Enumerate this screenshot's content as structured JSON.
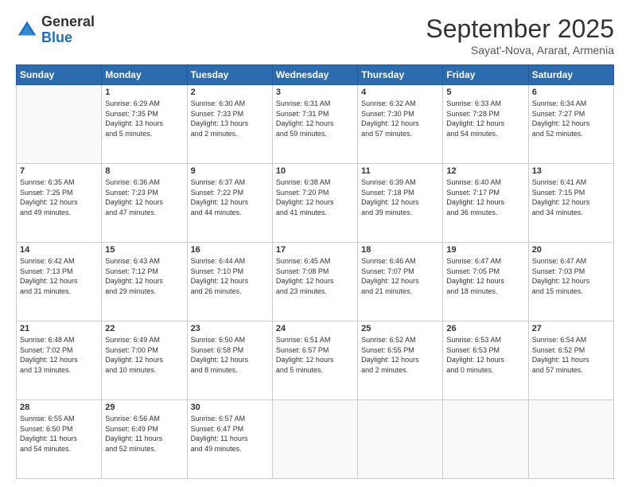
{
  "header": {
    "logo_general": "General",
    "logo_blue": "Blue",
    "month": "September 2025",
    "location": "Sayat'-Nova, Ararat, Armenia"
  },
  "columns": [
    "Sunday",
    "Monday",
    "Tuesday",
    "Wednesday",
    "Thursday",
    "Friday",
    "Saturday"
  ],
  "weeks": [
    [
      {
        "day": "",
        "text": ""
      },
      {
        "day": "1",
        "text": "Sunrise: 6:29 AM\nSunset: 7:35 PM\nDaylight: 13 hours\nand 5 minutes."
      },
      {
        "day": "2",
        "text": "Sunrise: 6:30 AM\nSunset: 7:33 PM\nDaylight: 13 hours\nand 2 minutes."
      },
      {
        "day": "3",
        "text": "Sunrise: 6:31 AM\nSunset: 7:31 PM\nDaylight: 12 hours\nand 59 minutes."
      },
      {
        "day": "4",
        "text": "Sunrise: 6:32 AM\nSunset: 7:30 PM\nDaylight: 12 hours\nand 57 minutes."
      },
      {
        "day": "5",
        "text": "Sunrise: 6:33 AM\nSunset: 7:28 PM\nDaylight: 12 hours\nand 54 minutes."
      },
      {
        "day": "6",
        "text": "Sunrise: 6:34 AM\nSunset: 7:27 PM\nDaylight: 12 hours\nand 52 minutes."
      }
    ],
    [
      {
        "day": "7",
        "text": "Sunrise: 6:35 AM\nSunset: 7:25 PM\nDaylight: 12 hours\nand 49 minutes."
      },
      {
        "day": "8",
        "text": "Sunrise: 6:36 AM\nSunset: 7:23 PM\nDaylight: 12 hours\nand 47 minutes."
      },
      {
        "day": "9",
        "text": "Sunrise: 6:37 AM\nSunset: 7:22 PM\nDaylight: 12 hours\nand 44 minutes."
      },
      {
        "day": "10",
        "text": "Sunrise: 6:38 AM\nSunset: 7:20 PM\nDaylight: 12 hours\nand 41 minutes."
      },
      {
        "day": "11",
        "text": "Sunrise: 6:39 AM\nSunset: 7:18 PM\nDaylight: 12 hours\nand 39 minutes."
      },
      {
        "day": "12",
        "text": "Sunrise: 6:40 AM\nSunset: 7:17 PM\nDaylight: 12 hours\nand 36 minutes."
      },
      {
        "day": "13",
        "text": "Sunrise: 6:41 AM\nSunset: 7:15 PM\nDaylight: 12 hours\nand 34 minutes."
      }
    ],
    [
      {
        "day": "14",
        "text": "Sunrise: 6:42 AM\nSunset: 7:13 PM\nDaylight: 12 hours\nand 31 minutes."
      },
      {
        "day": "15",
        "text": "Sunrise: 6:43 AM\nSunset: 7:12 PM\nDaylight: 12 hours\nand 29 minutes."
      },
      {
        "day": "16",
        "text": "Sunrise: 6:44 AM\nSunset: 7:10 PM\nDaylight: 12 hours\nand 26 minutes."
      },
      {
        "day": "17",
        "text": "Sunrise: 6:45 AM\nSunset: 7:08 PM\nDaylight: 12 hours\nand 23 minutes."
      },
      {
        "day": "18",
        "text": "Sunrise: 6:46 AM\nSunset: 7:07 PM\nDaylight: 12 hours\nand 21 minutes."
      },
      {
        "day": "19",
        "text": "Sunrise: 6:47 AM\nSunset: 7:05 PM\nDaylight: 12 hours\nand 18 minutes."
      },
      {
        "day": "20",
        "text": "Sunrise: 6:47 AM\nSunset: 7:03 PM\nDaylight: 12 hours\nand 15 minutes."
      }
    ],
    [
      {
        "day": "21",
        "text": "Sunrise: 6:48 AM\nSunset: 7:02 PM\nDaylight: 12 hours\nand 13 minutes."
      },
      {
        "day": "22",
        "text": "Sunrise: 6:49 AM\nSunset: 7:00 PM\nDaylight: 12 hours\nand 10 minutes."
      },
      {
        "day": "23",
        "text": "Sunrise: 6:50 AM\nSunset: 6:58 PM\nDaylight: 12 hours\nand 8 minutes."
      },
      {
        "day": "24",
        "text": "Sunrise: 6:51 AM\nSunset: 6:57 PM\nDaylight: 12 hours\nand 5 minutes."
      },
      {
        "day": "25",
        "text": "Sunrise: 6:52 AM\nSunset: 6:55 PM\nDaylight: 12 hours\nand 2 minutes."
      },
      {
        "day": "26",
        "text": "Sunrise: 6:53 AM\nSunset: 6:53 PM\nDaylight: 12 hours\nand 0 minutes."
      },
      {
        "day": "27",
        "text": "Sunrise: 6:54 AM\nSunset: 6:52 PM\nDaylight: 11 hours\nand 57 minutes."
      }
    ],
    [
      {
        "day": "28",
        "text": "Sunrise: 6:55 AM\nSunset: 6:50 PM\nDaylight: 11 hours\nand 54 minutes."
      },
      {
        "day": "29",
        "text": "Sunrise: 6:56 AM\nSunset: 6:49 PM\nDaylight: 11 hours\nand 52 minutes."
      },
      {
        "day": "30",
        "text": "Sunrise: 6:57 AM\nSunset: 6:47 PM\nDaylight: 11 hours\nand 49 minutes."
      },
      {
        "day": "",
        "text": ""
      },
      {
        "day": "",
        "text": ""
      },
      {
        "day": "",
        "text": ""
      },
      {
        "day": "",
        "text": ""
      }
    ]
  ]
}
